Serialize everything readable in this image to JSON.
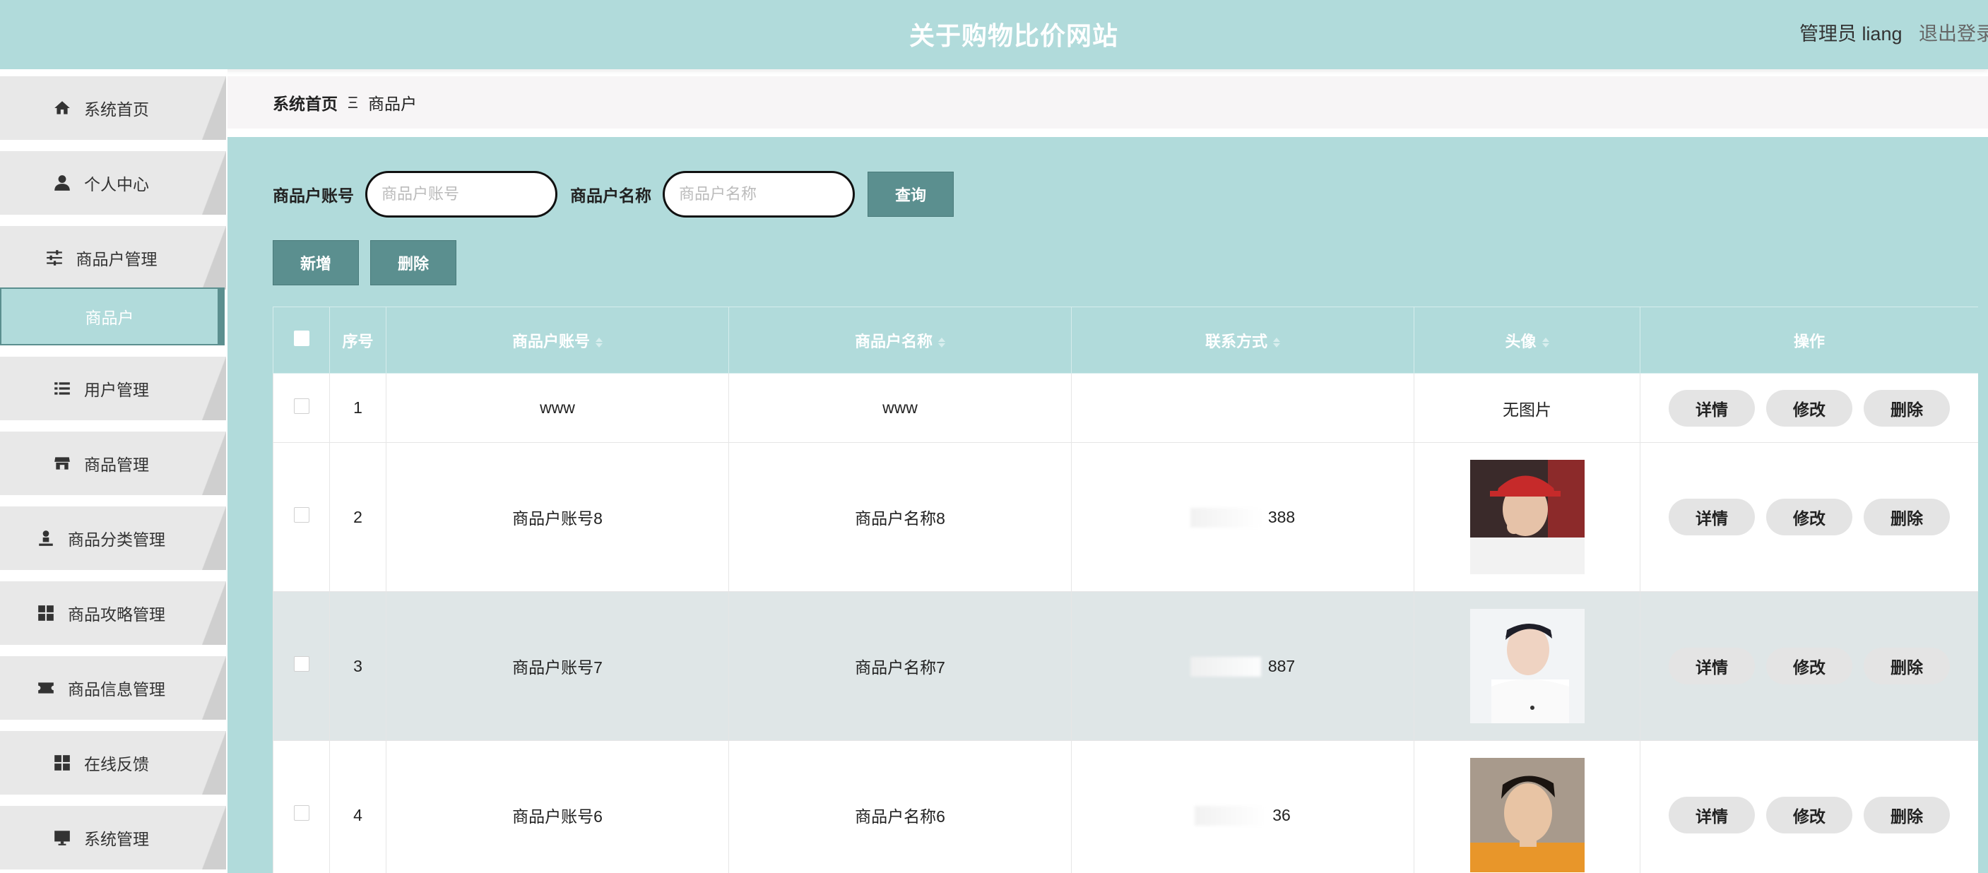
{
  "header": {
    "title": "关于购物比价网站",
    "user": "管理员 liang",
    "logout": "退出登录"
  },
  "sidebar": {
    "items": [
      {
        "label": "系统首页",
        "icon": "home-icon"
      },
      {
        "label": "个人中心",
        "icon": "user-icon"
      },
      {
        "label": "商品户管理",
        "icon": "sliders-icon"
      },
      {
        "label": "用户管理",
        "icon": "list-icon"
      },
      {
        "label": "商品管理",
        "icon": "store-icon"
      },
      {
        "label": "商品分类管理",
        "icon": "person-stand-icon"
      },
      {
        "label": "商品攻略管理",
        "icon": "grid-icon"
      },
      {
        "label": "商品信息管理",
        "icon": "ticket-icon"
      },
      {
        "label": "在线反馈",
        "icon": "grid-icon"
      },
      {
        "label": "系统管理",
        "icon": "monitor-icon"
      }
    ],
    "sub_active": "商品户"
  },
  "breadcrumb": {
    "home": "系统首页",
    "separator": "Ξ",
    "current": "商品户"
  },
  "search": {
    "account_label": "商品户账号",
    "account_placeholder": "商品户账号",
    "name_label": "商品户名称",
    "name_placeholder": "商品户名称",
    "query_button": "查询"
  },
  "actions": {
    "add": "新增",
    "delete": "删除"
  },
  "table": {
    "columns": [
      "序号",
      "商品户账号",
      "商品户名称",
      "联系方式",
      "头像",
      "操作"
    ],
    "rows": [
      {
        "index": "1",
        "account": "www",
        "name": "www",
        "contact": "",
        "avatar": "无图片"
      },
      {
        "index": "2",
        "account": "商品户账号8",
        "name": "商品户名称8",
        "contact": "388",
        "avatar": "photo"
      },
      {
        "index": "3",
        "account": "商品户账号7",
        "name": "商品户名称7",
        "contact": "887",
        "avatar": "photo"
      },
      {
        "index": "4",
        "account": "商品户账号6",
        "name": "商品户名称6",
        "contact": "36",
        "avatar": "photo"
      }
    ],
    "op_detail": "详情",
    "op_edit": "修改",
    "op_delete": "删除"
  },
  "colors": {
    "theme": "#b1dbdb",
    "button": "#5b8f8f",
    "row_highlight": "#dfe6e7"
  }
}
